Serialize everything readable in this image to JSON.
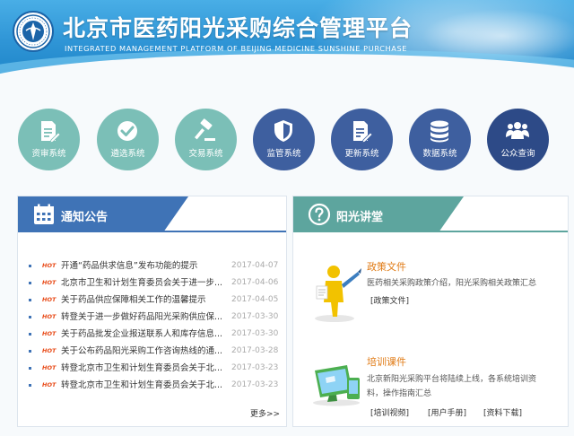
{
  "header": {
    "title": "北京市医药阳光采购综合管理平台",
    "subtitle": "INTEGRATED MANAGEMENT PLATFORM OF BEIJING MEDICINE SUNSHINE PURCHASE"
  },
  "nav": [
    {
      "label": "资审系统",
      "icon": "document-edit-icon"
    },
    {
      "label": "遴选系统",
      "icon": "check-circle-icon"
    },
    {
      "label": "交易系统",
      "icon": "gavel-icon"
    },
    {
      "label": "监管系统",
      "icon": "shield-icon"
    },
    {
      "label": "更新系统",
      "icon": "document-pen-icon"
    },
    {
      "label": "数据系统",
      "icon": "database-icon"
    },
    {
      "label": "公众查询",
      "icon": "users-icon"
    }
  ],
  "notice": {
    "title": "通知公告",
    "hot_label": "HOT",
    "items": [
      {
        "title": "开通“药品供求信息”发布功能的提示",
        "date": "2017-04-07"
      },
      {
        "title": "北京市卫生和计划生育委员会关于进一步...",
        "date": "2017-04-06"
      },
      {
        "title": "关于药品供应保障相关工作的温馨提示",
        "date": "2017-04-05"
      },
      {
        "title": "转登关于进一步做好药品阳光采购供应保...",
        "date": "2017-03-30"
      },
      {
        "title": "关于药品批发企业报送联系人和库存信息...",
        "date": "2017-03-30"
      },
      {
        "title": "关于公布药品阳光采购工作咨询热线的通...",
        "date": "2017-03-28"
      },
      {
        "title": "转登北京市卫生和计划生育委员会关于北...",
        "date": "2017-03-23"
      },
      {
        "title": "转登北京市卫生和计划生育委员会关于北...",
        "date": "2017-03-23"
      }
    ],
    "more": "更多>>"
  },
  "lecture": {
    "title": "阳光讲堂",
    "policy": {
      "heading": "政策文件",
      "desc": "医药相关采购政策介绍，阳光采购相关政策汇总",
      "link": "[政策文件]"
    },
    "training": {
      "heading": "培训课件",
      "desc": "北京新阳光采购平台将陆续上线，各系统培训资料，操作指南汇总",
      "links": [
        "[培训视频]",
        "[用户手册]",
        "[资料下载]"
      ]
    }
  },
  "colors": {
    "header_blue": "#2f95d6",
    "teal": "#7bbfb7",
    "navy": "#3e5f9f",
    "hot": "#e84c1a",
    "section_orange": "#e07a14"
  }
}
